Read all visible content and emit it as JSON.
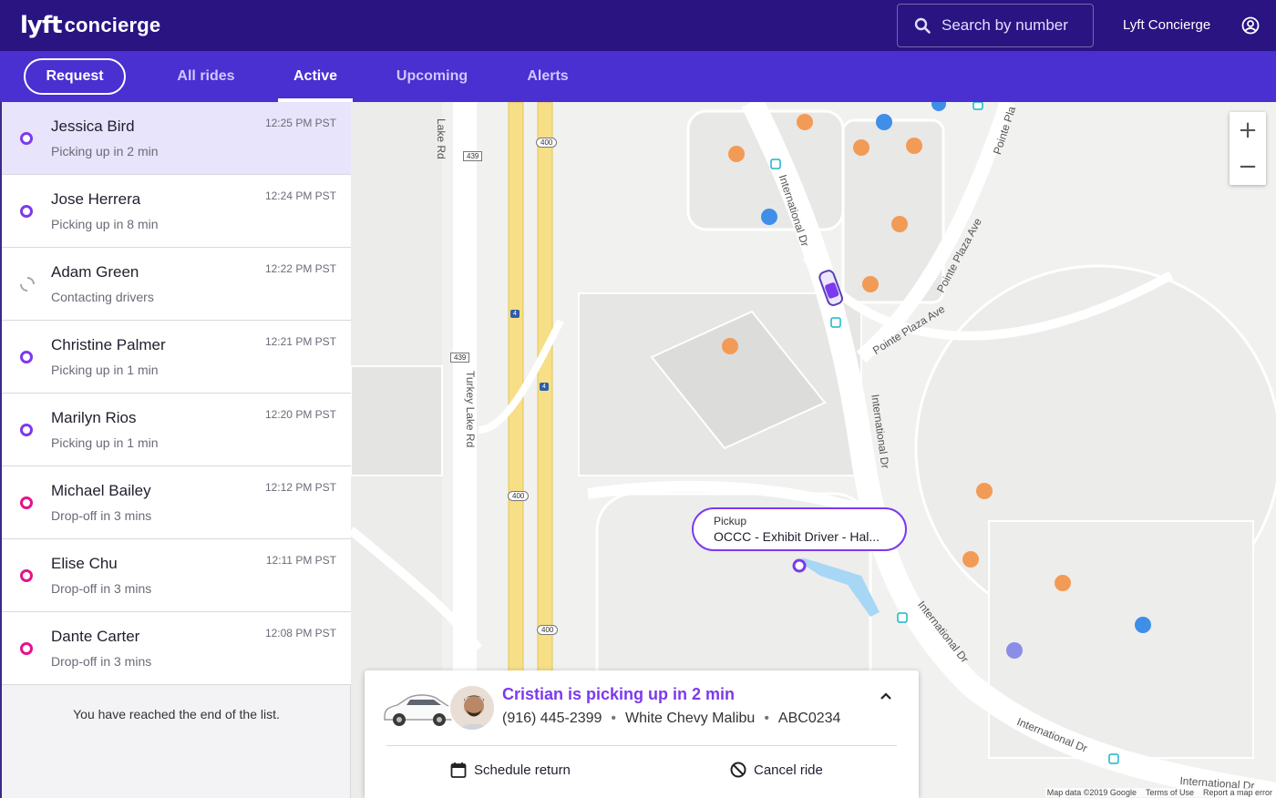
{
  "header": {
    "logo_mark": "lyft",
    "logo_text": "concierge",
    "search_placeholder": "Search by number",
    "user_name": "Lyft Concierge"
  },
  "nav": {
    "request_label": "Request",
    "tabs": [
      {
        "label": "All rides",
        "active": false
      },
      {
        "label": "Active",
        "active": true
      },
      {
        "label": "Upcoming",
        "active": false
      },
      {
        "label": "Alerts",
        "active": false
      }
    ]
  },
  "rides": [
    {
      "name": "Jessica Bird",
      "status": "Picking up in 2 min",
      "time": "12:25 PM PST",
      "state": "pickup",
      "selected": true
    },
    {
      "name": "Jose Herrera",
      "status": "Picking up in 8 min",
      "time": "12:24 PM PST",
      "state": "pickup"
    },
    {
      "name": "Adam Green",
      "status": "Contacting drivers",
      "time": "12:22 PM PST",
      "state": "loading"
    },
    {
      "name": "Christine Palmer",
      "status": "Picking up in 1 min",
      "time": "12:21 PM PST",
      "state": "pickup"
    },
    {
      "name": "Marilyn Rios",
      "status": "Picking up in 1 min",
      "time": "12:20 PM PST",
      "state": "pickup"
    },
    {
      "name": "Michael Bailey",
      "status": "Drop-off in 3 mins",
      "time": "12:12 PM PST",
      "state": "dropoff"
    },
    {
      "name": "Elise Chu",
      "status": "Drop-off in 3 mins",
      "time": "12:11 PM PST",
      "state": "dropoff"
    },
    {
      "name": "Dante Carter",
      "status": "Drop-off in 3 mins",
      "time": "12:08 PM PST",
      "state": "dropoff"
    }
  ],
  "end_of_list": "You have reached the end of the list.",
  "map": {
    "pickup_label": "Pickup",
    "pickup_value": "OCCC - Exhibit Driver - Hal...",
    "street_labels": [
      "Lake Rd",
      "Turkey Lake Rd",
      "International Dr",
      "International Dr",
      "International Dr",
      "International Dr",
      "International Dr",
      "Pointe Plaza Ave",
      "Pointe Plaza Ave",
      "Pointe Pla"
    ],
    "shields": [
      "439",
      "439",
      "400",
      "400",
      "400",
      "4",
      "4"
    ],
    "attribution": "Map data ©2019 Google",
    "terms": "Terms of Use",
    "report": "Report a map error",
    "zoom_in": "+",
    "zoom_out": "−"
  },
  "driver_card": {
    "headline": "Cristian is picking up in 2 min",
    "phone": "(916) 445-2399",
    "vehicle": "White Chevy Malibu",
    "plate": "ABC0234",
    "separator": "•",
    "schedule_label": "Schedule return",
    "cancel_label": "Cancel ride"
  },
  "colors": {
    "topbar": "#2a1482",
    "navbar": "#4a2fd1",
    "accent_purple": "#7c3aed",
    "dropoff_pink": "#e5128b",
    "selected_row": "#e7e4fb"
  }
}
